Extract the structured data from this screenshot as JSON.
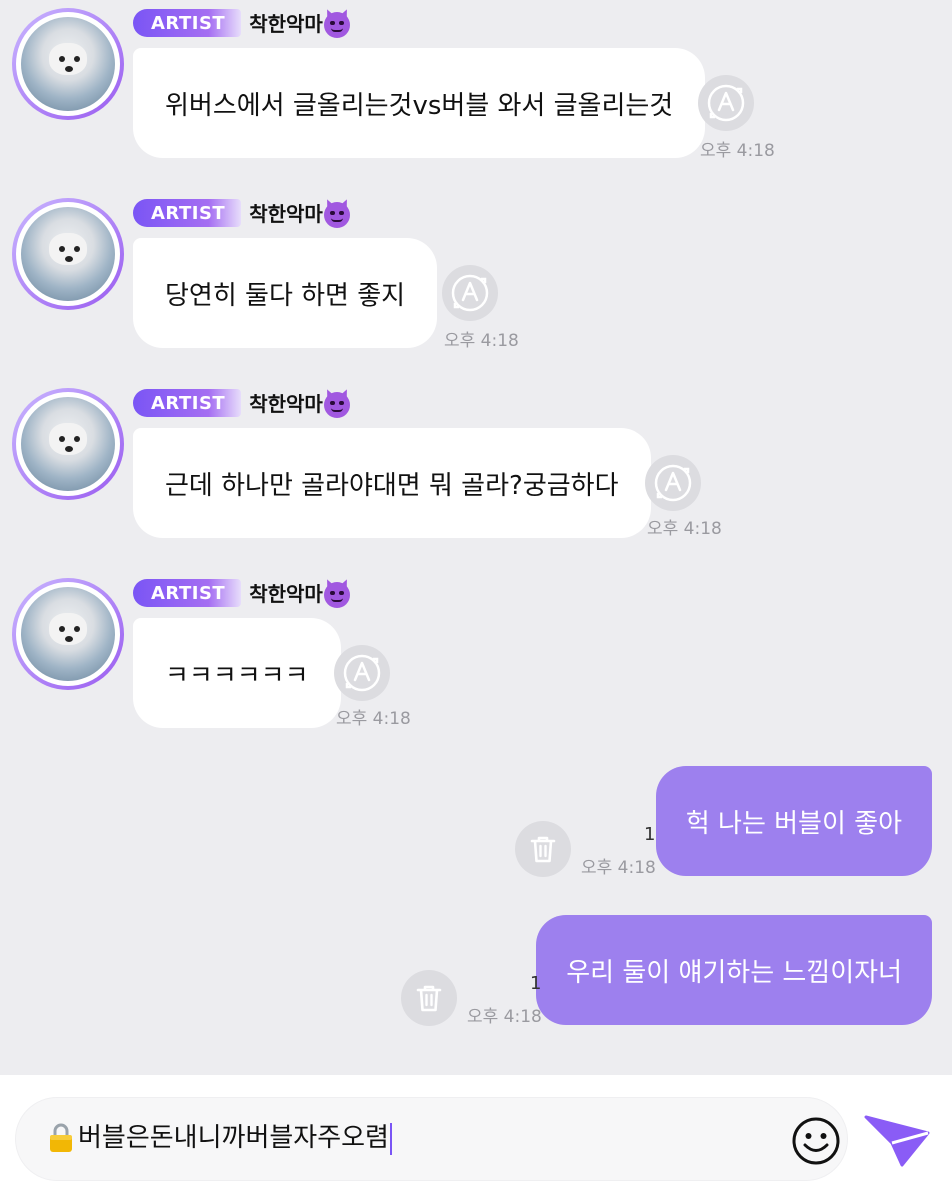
{
  "colors": {
    "background": "#ededf0",
    "user_bubble": "#9d80ee",
    "artist_bubble": "#ffffff",
    "badge_gradient_start": "#7a55f5",
    "badge_gradient_end": "#a56ef2",
    "accent": "#8a5cf6"
  },
  "messages": [
    {
      "type": "artist",
      "badge": "ARTIST",
      "sender": "착한악마",
      "sender_icon": "smiling-devil-emoji",
      "text": "위버스에서 글올리는것vs버블 와서 글올리는것",
      "time": "오후 4:18",
      "action_icon": "translate-icon"
    },
    {
      "type": "artist",
      "badge": "ARTIST",
      "sender": "착한악마",
      "sender_icon": "smiling-devil-emoji",
      "text": "당연히 둘다 하면 좋지",
      "time": "오후 4:18",
      "action_icon": "translate-icon"
    },
    {
      "type": "artist",
      "badge": "ARTIST",
      "sender": "착한악마",
      "sender_icon": "smiling-devil-emoji",
      "text": "근데 하나만 골라야대면 뭐 골라?궁금하다",
      "time": "오후 4:18",
      "action_icon": "translate-icon"
    },
    {
      "type": "artist",
      "badge": "ARTIST",
      "sender": "착한악마",
      "sender_icon": "smiling-devil-emoji",
      "text": "ㅋㅋㅋㅋㅋㅋ",
      "time": "오후 4:18",
      "action_icon": "translate-icon"
    },
    {
      "type": "user",
      "text": "헉 나는 버블이 좋아",
      "read_count": "1",
      "time": "오후 4:18",
      "action_icon": "trash-icon"
    },
    {
      "type": "user",
      "text": "우리 둘이 얘기하는 느낌이자너",
      "read_count": "1",
      "time": "오후 4:18",
      "action_icon": "trash-icon"
    }
  ],
  "input": {
    "lock_icon": "lock-emoji",
    "value": "버블은돈내니까버블자주오렴",
    "emoji_icon": "smiley-face-icon",
    "send_icon": "paper-plane-send-icon"
  }
}
